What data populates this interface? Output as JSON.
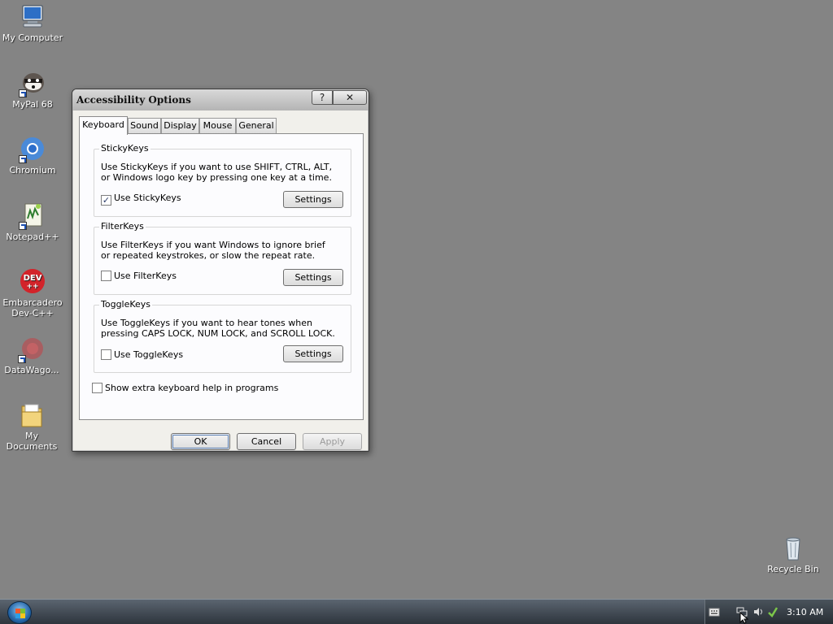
{
  "desktop": {
    "icons": [
      {
        "label": "My Computer",
        "icon": "computer-icon"
      },
      {
        "label": "MyPal 68",
        "icon": "mypal-icon"
      },
      {
        "label": "Chromium",
        "icon": "chromium-icon"
      },
      {
        "label": "Notepad++",
        "icon": "notepad-plus-plus-icon"
      },
      {
        "label": "Embarcadero Dev-C++",
        "icon": "devcpp-icon"
      },
      {
        "label": "DataWago...",
        "icon": "datawagon-icon"
      },
      {
        "label": "My Documents",
        "icon": "folder-icon"
      },
      {
        "label": "Recycle Bin",
        "icon": "recycle-bin-icon"
      }
    ]
  },
  "dialog": {
    "title": "Accessibility Options",
    "help_label": "?",
    "close_label": "✕",
    "tabs": [
      {
        "label": "Keyboard",
        "active": true
      },
      {
        "label": "Sound",
        "active": false
      },
      {
        "label": "Display",
        "active": false
      },
      {
        "label": "Mouse",
        "active": false
      },
      {
        "label": "General",
        "active": false
      }
    ],
    "stickykeys": {
      "title": "StickyKeys",
      "description": "Use StickyKeys if you want to use SHIFT, CTRL, ALT, or Windows logo key by pressing one key at a time.",
      "checkbox_label": "Use StickyKeys",
      "checked": true,
      "settings_label": "Settings"
    },
    "filterkeys": {
      "title": "FilterKeys",
      "description": "Use FilterKeys if you want Windows to ignore brief or repeated keystrokes, or slow the repeat rate.",
      "checkbox_label": "Use FilterKeys",
      "checked": false,
      "settings_label": "Settings"
    },
    "togglekeys": {
      "title": "ToggleKeys",
      "description": "Use ToggleKeys if you want to hear tones when pressing CAPS LOCK, NUM LOCK, and SCROLL LOCK.",
      "checkbox_label": "Use ToggleKeys",
      "checked": false,
      "settings_label": "Settings"
    },
    "extra_help": {
      "label": "Show extra keyboard help in programs",
      "checked": false
    },
    "buttons": {
      "ok": "OK",
      "cancel": "Cancel",
      "apply": "Apply"
    }
  },
  "taskbar": {
    "start_icon": "windows-start-icon",
    "tray_icons": [
      "keyboard-icon",
      "network-icon",
      "speaker-icon",
      "security-icon"
    ],
    "clock": "3:10 AM"
  },
  "colors": {
    "desktop_bg": "#848484",
    "dialog_bg": "#f1f0eb",
    "taskbar_bg": "#3a424b"
  }
}
